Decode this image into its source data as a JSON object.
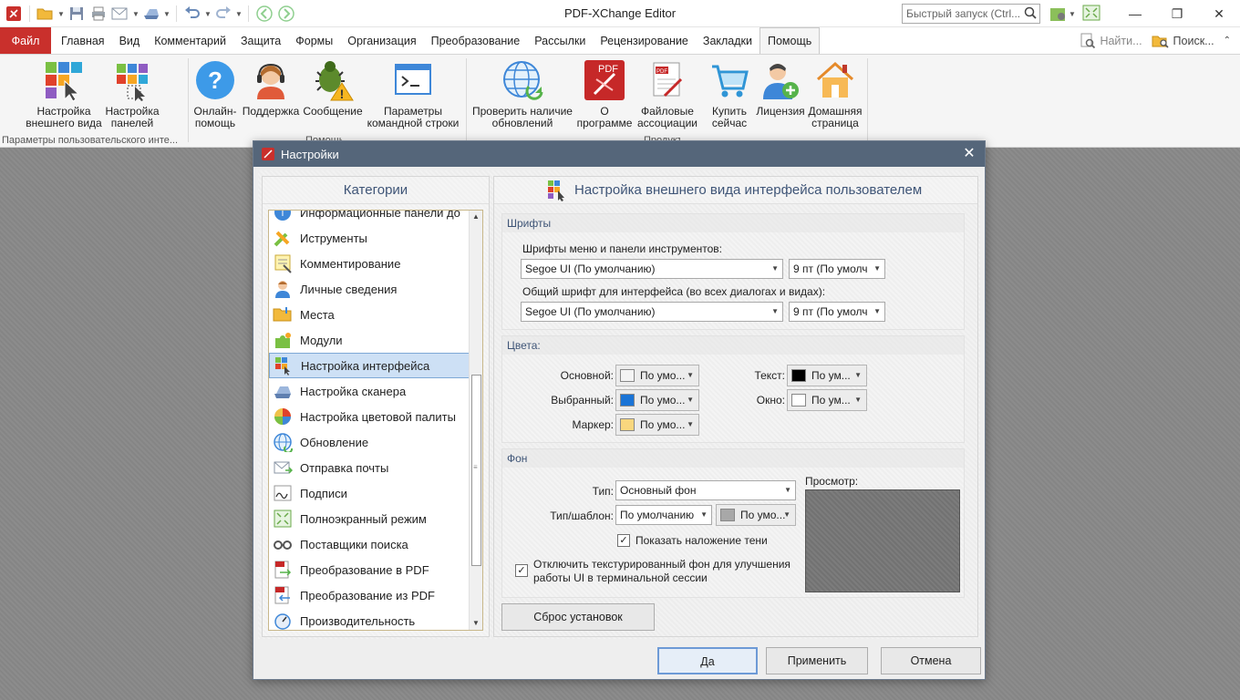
{
  "app": {
    "title": "PDF-XChange Editor",
    "quick_search_placeholder": "Быстрый запуск (Ctrl...",
    "accent": "#c9302c"
  },
  "tabs": [
    {
      "label": "Файл"
    },
    {
      "label": "Главная"
    },
    {
      "label": "Вид"
    },
    {
      "label": "Комментарий"
    },
    {
      "label": "Защита"
    },
    {
      "label": "Формы"
    },
    {
      "label": "Организация"
    },
    {
      "label": "Преобразование"
    },
    {
      "label": "Рассылки"
    },
    {
      "label": "Рецензирование"
    },
    {
      "label": "Закладки"
    },
    {
      "label": "Помощь"
    }
  ],
  "tabs_right": {
    "find": "Найти...",
    "search": "Поиск..."
  },
  "ribbon": {
    "buttons": [
      {
        "line1": "Настройка",
        "line2": "внешнего вида"
      },
      {
        "line1": "Настройка",
        "line2": "панелей"
      },
      {
        "line1": "Онлайн-",
        "line2": "помощь"
      },
      {
        "line1": "Поддержка",
        "line2": ""
      },
      {
        "line1": "Сообщение",
        "line2": ""
      },
      {
        "line1": "Параметры",
        "line2": "командной строки"
      },
      {
        "line1": "Проверить наличие",
        "line2": "обновлений"
      },
      {
        "line1": "О",
        "line2": "программе"
      },
      {
        "line1": "Файловые",
        "line2": "ассоциации"
      },
      {
        "line1": "Купить",
        "line2": "сейчас"
      },
      {
        "line1": "Лицензия",
        "line2": ""
      },
      {
        "line1": "Домашняя",
        "line2": "страница"
      }
    ],
    "group_labels": {
      "ui": "Параметры пользовательского инте...",
      "help": "Помощь",
      "product": "Продукт"
    }
  },
  "dialog": {
    "title": "Настройки",
    "categories_header": "Категории",
    "categories": [
      {
        "label": "Информационные панели до",
        "icon": "info-panel-icon"
      },
      {
        "label": "Иструменты",
        "icon": "tools-icon"
      },
      {
        "label": "Комментирование",
        "icon": "comment-icon"
      },
      {
        "label": "Личные сведения",
        "icon": "person-icon"
      },
      {
        "label": "Места",
        "icon": "folder-icon"
      },
      {
        "label": "Модули",
        "icon": "puzzle-icon"
      },
      {
        "label": "Настройка интерфейса",
        "icon": "ui-tiles-icon"
      },
      {
        "label": "Настройка сканера",
        "icon": "scanner-icon"
      },
      {
        "label": "Настройка цветовой палиты",
        "icon": "palette-icon"
      },
      {
        "label": "Обновление",
        "icon": "globe-update-icon"
      },
      {
        "label": "Отправка почты",
        "icon": "mail-icon"
      },
      {
        "label": "Подписи",
        "icon": "signature-icon"
      },
      {
        "label": "Полноэкранный режим",
        "icon": "fullscreen-icon"
      },
      {
        "label": "Поставщики поиска",
        "icon": "search-provider-icon"
      },
      {
        "label": "Преобразование в PDF",
        "icon": "to-pdf-icon"
      },
      {
        "label": "Преобразование из PDF",
        "icon": "from-pdf-icon"
      },
      {
        "label": "Производительность",
        "icon": "performance-icon"
      }
    ],
    "selected_category": "Настройка интерфейса",
    "panel_title": "Настройка внешнего вида интерфейса пользователем",
    "fonts": {
      "title": "Шрифты",
      "menu_label": "Шрифты меню и панели инструментов:",
      "menu_font": "Segoe UI (По умолчанию)",
      "menu_size": "9 пт (По умолч",
      "general_label": "Общий шрифт для интерфейса (во всех диалогах и видах):",
      "general_font": "Segoe UI (По умолчанию)",
      "general_size": "9 пт (По умолч"
    },
    "colors": {
      "title": "Цвета:",
      "main_label": "Основной:",
      "main_value": "По умо...",
      "main_color": "#f4f4f4",
      "selected_label": "Выбранный:",
      "selected_value": "По умо...",
      "selected_color": "#1a74d6",
      "marker_label": "Маркер:",
      "marker_value": "По умо...",
      "marker_color": "#f9d77e",
      "text_label": "Текст:",
      "text_value": "По ум...",
      "text_color": "#000000",
      "window_label": "Окно:",
      "window_value": "По ум...",
      "window_color": "#ffffff"
    },
    "background": {
      "title": "Фон",
      "type_label": "Тип:",
      "type_value": "Основный фон",
      "template_label": "Тип/шаблон:",
      "template_value": "По умолчанию",
      "template_color_value": "По умо...",
      "template_color": "#a8a8a8",
      "shadow_label": "Показать наложение тени",
      "shadow_checked": true,
      "preview_label": "Просмотр:",
      "disable_texture_line1": "Отключить текстурированный фон для улучшения",
      "disable_texture_line2": "работы UI в терминальной сессии",
      "disable_texture_checked": true
    },
    "reset_button": "Сброс установок",
    "ok_button": "Да",
    "apply_button": "Применить",
    "cancel_button": "Отмена"
  }
}
